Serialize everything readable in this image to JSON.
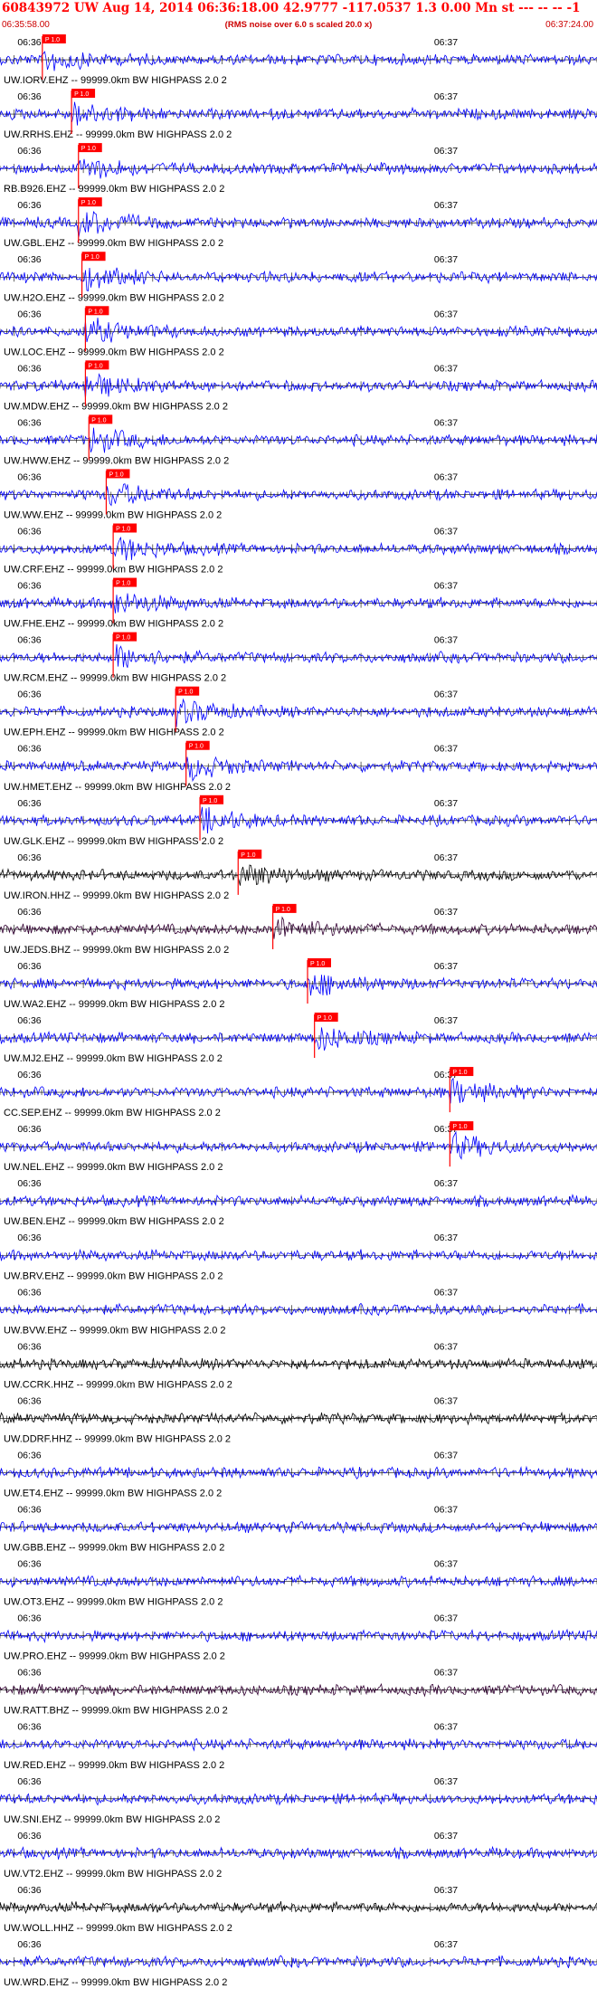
{
  "header": {
    "title": "60843972 UW Aug 14, 2014 06:36:18.00   42.9777 -117.0537  1.3 0.00 Mn st --- -- --  -1",
    "end_marker": "",
    "start_time": "06:35:58.00",
    "note": "(RMS noise over 6.0 s scaled 20.0 x)",
    "end_time": "06:37:24.00"
  },
  "minute_labels": [
    "06:36",
    "06:37"
  ],
  "pick_label": "P 1.0",
  "colors": {
    "blue": "#0000ff",
    "black": "#000000",
    "purple": "#330033",
    "red": "#ff0000",
    "header_red": "#ff0000"
  },
  "stations": [
    {
      "label": "UW.IORV.EHZ -- 99999.0km BW  HIGHPASS  2.0  2",
      "color": "blue",
      "pick": 0.48
    },
    {
      "label": "UW.RRHS.EHZ -- 99999.0km BW  HIGHPASS  2.0  2",
      "color": "blue",
      "pick": 0.9
    },
    {
      "label": "RB.B926.EHZ -- 99999.0km BW  HIGHPASS  2.0  2",
      "color": "blue",
      "pick": 1.0
    },
    {
      "label": "UW.GBL.EHZ -- 99999.0km BW  HIGHPASS  2.0  2",
      "color": "blue",
      "pick": 1.0
    },
    {
      "label": "UW.H2O.EHZ -- 99999.0km BW  HIGHPASS  2.0  2",
      "color": "blue",
      "pick": 1.05
    },
    {
      "label": "UW.LOC.EHZ -- 99999.0km BW  HIGHPASS  2.0  2",
      "color": "blue",
      "pick": 1.1
    },
    {
      "label": "UW.MDW.EHZ -- 99999.0km BW  HIGHPASS  2.0  2",
      "color": "blue",
      "pick": 1.1
    },
    {
      "label": "UW.HWW.EHZ -- 99999.0km BW  HIGHPASS  2.0  2",
      "color": "blue",
      "pick": 1.15
    },
    {
      "label": "UW.WW.EHZ -- 99999.0km BW  HIGHPASS  2.0  2",
      "color": "blue",
      "pick": 1.4
    },
    {
      "label": "UW.CRF.EHZ -- 99999.0km BW  HIGHPASS  2.0  2",
      "color": "blue",
      "pick": 1.5
    },
    {
      "label": "UW.FHE.EHZ -- 99999.0km BW  HIGHPASS  2.0  2",
      "color": "blue",
      "pick": 1.5
    },
    {
      "label": "UW.RCM.EHZ -- 99999.0km BW  HIGHPASS  2.0  2",
      "color": "blue",
      "pick": 1.5
    },
    {
      "label": "UW.EPH.EHZ -- 99999.0km BW  HIGHPASS  2.0  2",
      "color": "blue",
      "pick": 2.4
    },
    {
      "label": "UW.HMET.EHZ -- 99999.0km BW  HIGHPASS  2.0  2",
      "color": "blue",
      "pick": 2.55
    },
    {
      "label": "UW.GLK.EHZ -- 99999.0km BW  HIGHPASS  2.0  2",
      "color": "blue",
      "pick": 2.75
    },
    {
      "label": "UW.IRON.HHZ -- 99999.0km BW  HIGHPASS  2.0  2",
      "color": "black",
      "pick": 3.3
    },
    {
      "label": "UW.JEDS.BHZ -- 99999.0km BW  HIGHPASS  2.0  2",
      "color": "purple",
      "pick": 3.8
    },
    {
      "label": "UW.WA2.EHZ -- 99999.0km BW  HIGHPASS  2.0  2",
      "color": "blue",
      "pick": 4.3
    },
    {
      "label": "UW.MJ2.EHZ -- 99999.0km BW  HIGHPASS  2.0  2",
      "color": "blue",
      "pick": 4.4
    },
    {
      "label": "CC.SEP.EHZ -- 99999.0km BW  HIGHPASS  2.0  2",
      "color": "blue",
      "pick": 6.35
    },
    {
      "label": "UW.NEL.EHZ -- 99999.0km BW  HIGHPASS  2.0  2",
      "color": "blue",
      "pick": 6.35
    },
    {
      "label": "UW.BEN.EHZ -- 99999.0km BW  HIGHPASS  2.0  2",
      "color": "blue",
      "pick": null
    },
    {
      "label": "UW.BRV.EHZ -- 99999.0km BW  HIGHPASS  2.0  2",
      "color": "blue",
      "pick": null
    },
    {
      "label": "UW.BVW.EHZ -- 99999.0km BW  HIGHPASS  2.0  2",
      "color": "blue",
      "pick": null
    },
    {
      "label": "UW.CCRK.HHZ -- 99999.0km BW  HIGHPASS  2.0  2",
      "color": "black",
      "pick": null
    },
    {
      "label": "UW.DDRF.HHZ -- 99999.0km BW  HIGHPASS  2.0  2",
      "color": "black",
      "pick": null
    },
    {
      "label": "UW.ET4.EHZ -- 99999.0km BW  HIGHPASS  2.0  2",
      "color": "blue",
      "pick": null
    },
    {
      "label": "UW.GBB.EHZ -- 99999.0km BW  HIGHPASS  2.0  2",
      "color": "blue",
      "pick": null
    },
    {
      "label": "UW.OT3.EHZ -- 99999.0km BW  HIGHPASS  2.0  2",
      "color": "blue",
      "pick": null
    },
    {
      "label": "UW.PRO.EHZ -- 99999.0km BW  HIGHPASS  2.0  2",
      "color": "blue",
      "pick": null
    },
    {
      "label": "UW.RATT.BHZ -- 99999.0km BW  HIGHPASS  2.0  2",
      "color": "purple",
      "pick": null
    },
    {
      "label": "UW.RED.EHZ -- 99999.0km BW  HIGHPASS  2.0  2",
      "color": "blue",
      "pick": null
    },
    {
      "label": "UW.SNI.EHZ -- 99999.0km BW  HIGHPASS  2.0  2",
      "color": "blue",
      "pick": null
    },
    {
      "label": "UW.VT2.EHZ -- 99999.0km BW  HIGHPASS  2.0  2",
      "color": "blue",
      "pick": null
    },
    {
      "label": "UW.WOLL.HHZ -- 99999.0km BW  HIGHPASS  2.0  2",
      "color": "black",
      "pick": null
    },
    {
      "label": "UW.WRD.EHZ -- 99999.0km BW  HIGHPASS  2.0  2",
      "color": "blue",
      "pick": null
    }
  ]
}
